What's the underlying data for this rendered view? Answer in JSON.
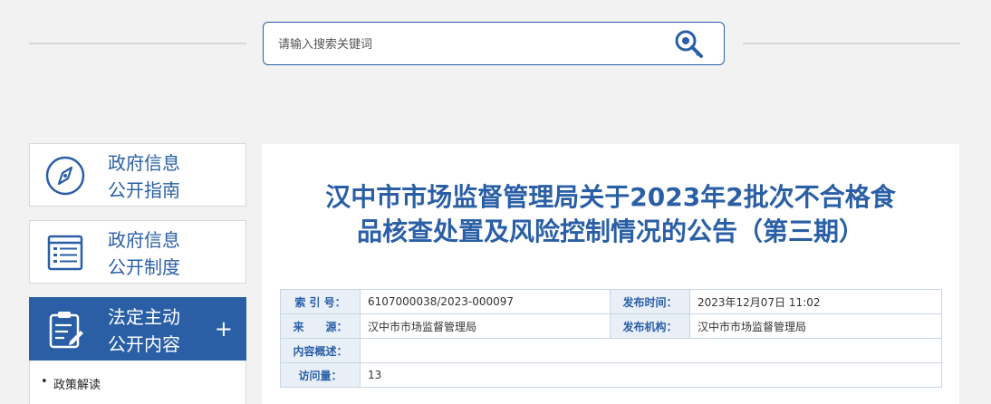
{
  "search": {
    "placeholder": "请输入搜索关键词"
  },
  "sidebar": {
    "items": [
      {
        "line1": "政府信息",
        "line2": "公开指南",
        "icon": "compass-icon"
      },
      {
        "line1": "政府信息",
        "line2": "公开制度",
        "icon": "document-list-icon"
      },
      {
        "line1": "法定主动",
        "line2": "公开内容",
        "icon": "clipboard-edit-icon",
        "expand": "+"
      }
    ],
    "sub_items": [
      "政策解读"
    ]
  },
  "article": {
    "title_line1": "汉中市市场监督管理局关于2023年2批次不合格食",
    "title_line2": "品核查处置及风险控制情况的公告（第三期）"
  },
  "meta": {
    "index_label": "索 引 号：",
    "index_value": "6107000038/2023-000097",
    "date_label": "发布时间：",
    "date_value": "2023年12月07日 11:02",
    "source_label": "来　　源：",
    "source_value": "汉中市市场监督管理局",
    "org_label": "发布机构：",
    "org_value": "汉中市市场监督管理局",
    "summary_label": "内容概述：",
    "summary_value": "",
    "views_label": "访问量：",
    "views_value": "13"
  },
  "colors": {
    "brand": "#2a5fa6",
    "label_bg": "#e8eff7",
    "page_bg": "#f2f2f2"
  }
}
